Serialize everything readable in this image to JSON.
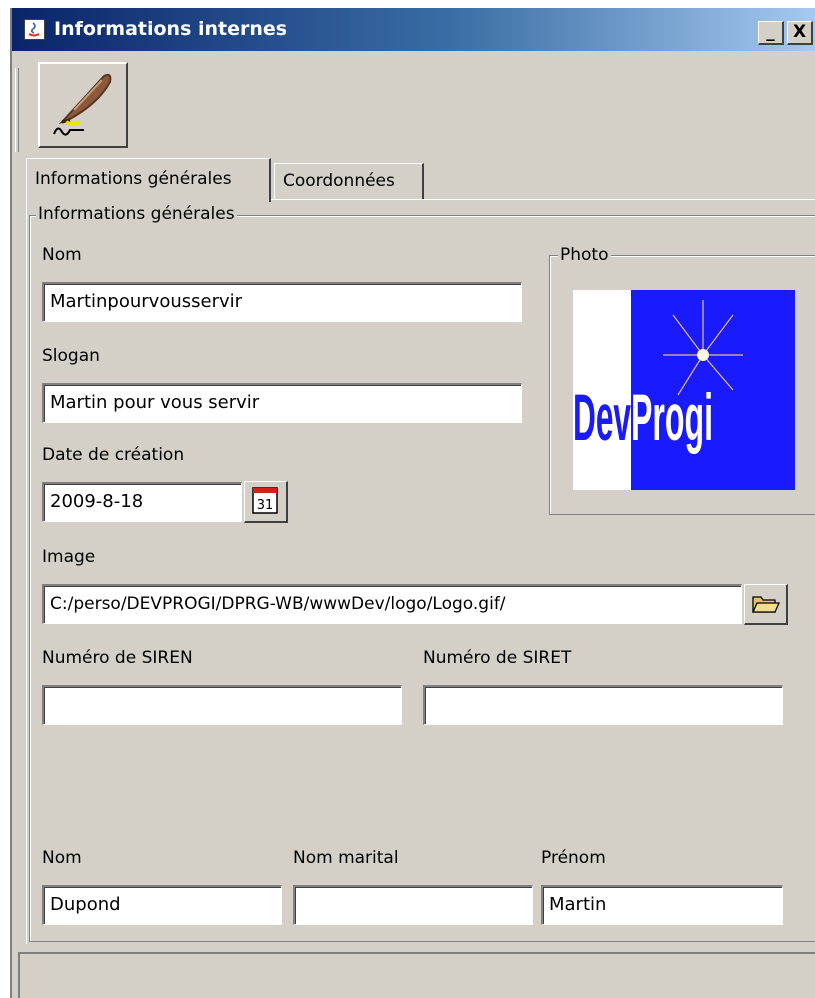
{
  "window": {
    "title": "Informations internes",
    "minimize_label": "_",
    "close_label": "X"
  },
  "toolbar": {
    "edit_icon": "quill-pen-icon"
  },
  "tabs": [
    {
      "label": "Informations générales",
      "active": true
    },
    {
      "label": "Coordonnées",
      "active": false
    }
  ],
  "group": {
    "legend": "Informations générales",
    "nom_label": "Nom",
    "nom_value": "Martinpourvousservir",
    "slogan_label": "Slogan",
    "slogan_value": "Martin pour vous servir",
    "date_label": "Date de création",
    "date_value": "2009-8-18",
    "calendar_day": "31",
    "image_label": "Image",
    "image_value": "C:/perso/DEVPROGI/DPRG-WB/wwwDev/logo/Logo.gif/",
    "siren_label": "Numéro de SIREN",
    "siren_value": "",
    "siret_label": "Numéro de SIRET",
    "siret_value": "",
    "photo_legend": "Photo",
    "logo_text_dev": "Dev",
    "logo_text_progi": "Progi",
    "person": {
      "nom_label": "Nom",
      "nom_value": "Dupond",
      "nom_marital_label": "Nom marital",
      "nom_marital_value": "",
      "prenom_label": "Prénom",
      "prenom_value": "Martin"
    }
  },
  "colors": {
    "window_bg": "#d4d0c8",
    "title_start": "#0a246a",
    "title_end": "#a6caf0",
    "logo_blue": "#1a1aff"
  }
}
